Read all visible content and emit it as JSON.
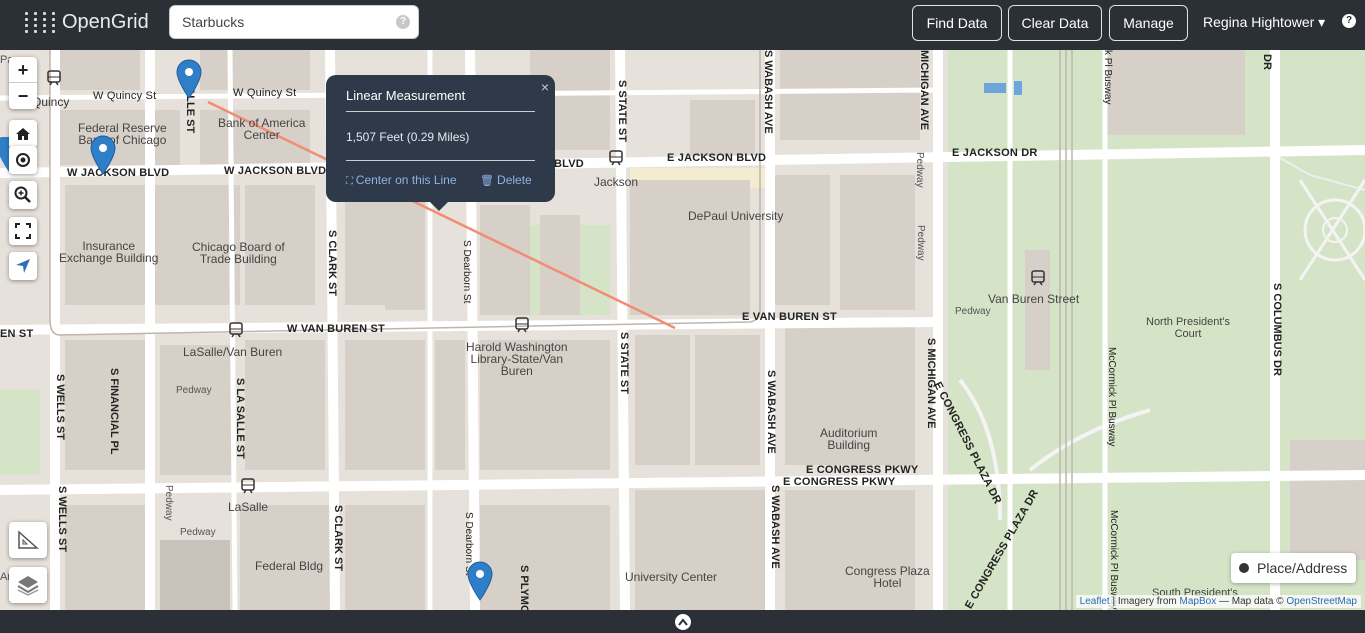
{
  "app": {
    "name": "OpenGrid"
  },
  "search": {
    "value": "Starbucks",
    "help": "?"
  },
  "header": {
    "buttons": {
      "find": "Find Data",
      "clear": "Clear Data",
      "manage": "Manage"
    },
    "user": "Regina Hightower ▾",
    "help": "?"
  },
  "map_controls": {
    "zoom_in": "+",
    "zoom_out": "−"
  },
  "popup": {
    "title": "Linear Measurement",
    "close": "×",
    "measurement": "1,507 Feet (0.29 Miles)",
    "center_link": "Center on this Line",
    "delete_link": "Delete"
  },
  "streets": {
    "w_quincy_1": "W Quincy St",
    "w_quincy_2": "W Quincy St",
    "quincy": "Quincy",
    "w_jackson_1": "W JACKSON BLVD",
    "w_jackson_2": "W JACKSON BLVD",
    "e_jackson_blvd": "E JACKSON BLVD",
    "e_jackson_dr": "E JACKSON DR",
    "blvd": "BLVD",
    "w_van_buren": "W VAN BUREN ST",
    "e_van_buren": "E VAN BUREN ST",
    "en_st": "EN ST",
    "e_congress_1": "E CONGRESS PKWY",
    "e_congress_2": "E CONGRESS PKWY",
    "s_clark_1": "S CLARK ST",
    "s_clark_2": "S CLARK ST",
    "s_dearborn_1": "S Dearborn St",
    "s_dearborn_2": "S Dearborn St",
    "s_state_top": "S STATE ST",
    "s_state": "S STATE ST",
    "s_wabash_top": "S WABASH AVE",
    "s_wabash_1": "S WABASH AVE",
    "s_wabash_2": "S WABASH AVE",
    "s_michigan_top": "MICHIGAN AVE",
    "s_michigan": "S MICHIGAN AVE",
    "s_wells_1": "S WELLS ST",
    "s_wells_2": "S WELLS ST",
    "s_financial": "S FINANCIAL PL",
    "s_lasalle": "S LA SALLE ST",
    "salle_st": "SALLE ST",
    "s_plymouth": "S PLYMO",
    "s_columbus": "S COLUMBUS DR",
    "dr_top": "DR",
    "congress_plaza_1": "E CONGRESS PLAZA DR",
    "congress_plaza_2": "E CONGRESS PLAZA DR",
    "mccormick_1": "McCormick Pl Busway",
    "mccormick_2": "McCormick Pl Busway",
    "busway_top": "k Pl Busway",
    "pedway_1": "Pedway",
    "pedway_2": "Pedway",
    "pedway_3": "Pedway",
    "pedway_4": "Pedway",
    "pedway_5": "Pedway",
    "pedway_6": "Pedway",
    "pedway_7": "Pedway",
    "pa": "Pa",
    "an": "An"
  },
  "places": {
    "federal_reserve": "Federal Reserve\nBank of Chicago",
    "bank_of_america": "Bank of America\nCenter",
    "insurance_exchange": "Insurance\nExchange Building",
    "board_of_trade": "Chicago Board of\nTrade Building",
    "depaul": "DePaul University",
    "jackson": "Jackson",
    "van_buren_street": "Van Buren Street",
    "north_presidents": "North President's\nCourt",
    "lasalle_van_buren": "LaSalle/Van Buren",
    "harold_washington": "Harold Washington\nLibrary-State/Van\nBuren",
    "auditorium": "Auditorium\nBuilding",
    "lasalle": "LaSalle",
    "federal_bldg": "Federal Bldg",
    "university_center": "University Center",
    "congress_plaza_hotel": "Congress Plaza\nHotel",
    "south_presidents": "South President's"
  },
  "place_search": {
    "label": "Place/Address"
  },
  "attribution": {
    "leaflet": "Leaflet",
    "imagery": " | Imagery from ",
    "mapbox": "MapBox",
    "mapdata": " — Map data © ",
    "osm": "OpenStreetMap"
  },
  "colors": {
    "topbar": "#2b2f36",
    "popup": "#2e3a4a",
    "measure_line": "#f28c73",
    "marker": "#2f7fc8",
    "park": "#d5e4c6",
    "map_bg": "#e6e1da"
  }
}
